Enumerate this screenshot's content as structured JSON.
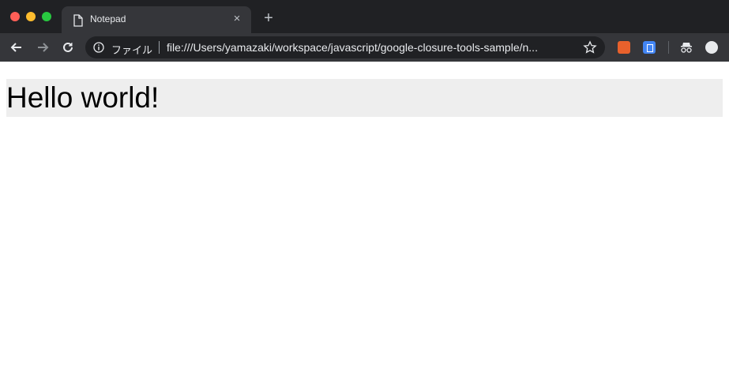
{
  "window": {
    "tab": {
      "title": "Notepad",
      "close_glyph": "×"
    },
    "new_tab_glyph": "+"
  },
  "toolbar": {
    "omnibox": {
      "scheme_label": "ファイル",
      "url": "file:///Users/yamazaki/workspace/javascript/google-closure-tools-sample/n..."
    },
    "icons": [
      "back-arrow-icon",
      "forward-arrow-icon",
      "reload-icon",
      "info-icon",
      "star-icon",
      "extension-icon",
      "extension-icon",
      "incognito-icon",
      "profile-avatar-icon"
    ]
  },
  "page": {
    "heading": "Hello world!"
  },
  "colors": {
    "titlebar": "#202124",
    "toolbar": "#35363a",
    "omnibox": "#202124",
    "heading_background": "#eeeeee"
  }
}
